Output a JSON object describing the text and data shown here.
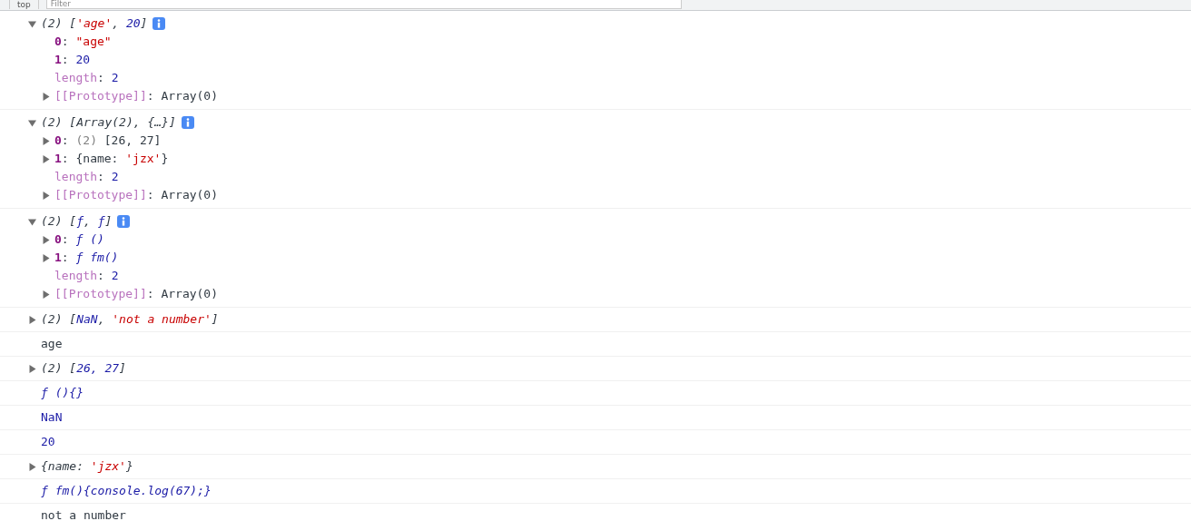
{
  "toolbar": {
    "context": "top",
    "filter": {
      "placeholder": "Filter"
    }
  },
  "entries": [
    {
      "expanded": true,
      "tokens": [
        {
          "text": "(2) [",
          "kind": "plain"
        },
        {
          "text": "'age'",
          "kind": "string"
        },
        {
          "text": ", ",
          "kind": "plain"
        },
        {
          "text": "20",
          "kind": "number"
        },
        {
          "text": "]",
          "kind": "plain"
        }
      ],
      "children": [
        {
          "tokens": [
            {
              "text": "0",
              "kind": "index"
            },
            {
              "text": ": ",
              "kind": "plain"
            },
            {
              "text": "\"age\"",
              "kind": "string"
            }
          ]
        },
        {
          "tokens": [
            {
              "text": "1",
              "kind": "index"
            },
            {
              "text": ": ",
              "kind": "plain"
            },
            {
              "text": "20",
              "kind": "number"
            }
          ]
        },
        {
          "tokens": [
            {
              "text": "length",
              "kind": "prop"
            },
            {
              "text": ": ",
              "kind": "plain"
            },
            {
              "text": "2",
              "kind": "number"
            }
          ]
        },
        {
          "expanded": false,
          "tokens": [
            {
              "text": "[[Prototype]]",
              "kind": "prop"
            },
            {
              "text": ": Array(0)",
              "kind": "plain"
            }
          ]
        }
      ]
    },
    {
      "expanded": true,
      "tokens": [
        {
          "text": "(2) [Array(2), {…}]",
          "kind": "plain"
        }
      ],
      "children": [
        {
          "expanded": false,
          "tokens": [
            {
              "text": "0",
              "kind": "index"
            },
            {
              "text": ": ",
              "kind": "plain"
            },
            {
              "text": "(2) ",
              "kind": "dim"
            },
            {
              "text": "[26, 27]",
              "kind": "plain"
            }
          ]
        },
        {
          "expanded": false,
          "tokens": [
            {
              "text": "1",
              "kind": "index"
            },
            {
              "text": ": {name: ",
              "kind": "plain"
            },
            {
              "text": "'jzx'",
              "kind": "string"
            },
            {
              "text": "}",
              "kind": "plain"
            }
          ]
        },
        {
          "tokens": [
            {
              "text": "length",
              "kind": "prop"
            },
            {
              "text": ": ",
              "kind": "plain"
            },
            {
              "text": "2",
              "kind": "number"
            }
          ]
        },
        {
          "expanded": false,
          "tokens": [
            {
              "text": "[[Prototype]]",
              "kind": "prop"
            },
            {
              "text": ": Array(0)",
              "kind": "plain"
            }
          ]
        }
      ]
    },
    {
      "expanded": true,
      "tokens": [
        {
          "text": "(2) [",
          "kind": "plain"
        },
        {
          "text": "ƒ",
          "kind": "func"
        },
        {
          "text": ", ",
          "kind": "plain"
        },
        {
          "text": "ƒ",
          "kind": "func"
        },
        {
          "text": "]",
          "kind": "plain"
        }
      ],
      "children": [
        {
          "expanded": false,
          "tokens": [
            {
              "text": "0",
              "kind": "index"
            },
            {
              "text": ": ",
              "kind": "plain"
            },
            {
              "text": "ƒ ()",
              "kind": "func"
            }
          ]
        },
        {
          "expanded": false,
          "tokens": [
            {
              "text": "1",
              "kind": "index"
            },
            {
              "text": ": ",
              "kind": "plain"
            },
            {
              "text": "ƒ fm()",
              "kind": "func"
            }
          ]
        },
        {
          "tokens": [
            {
              "text": "length",
              "kind": "prop"
            },
            {
              "text": ": ",
              "kind": "plain"
            },
            {
              "text": "2",
              "kind": "number"
            }
          ]
        },
        {
          "expanded": false,
          "tokens": [
            {
              "text": "[[Prototype]]",
              "kind": "prop"
            },
            {
              "text": ": Array(0)",
              "kind": "plain"
            }
          ]
        }
      ]
    },
    {
      "expanded": false,
      "tokens": [
        {
          "text": "(2) [",
          "kind": "plain"
        },
        {
          "text": "NaN",
          "kind": "number"
        },
        {
          "text": ", ",
          "kind": "plain"
        },
        {
          "text": "'not a number'",
          "kind": "string"
        },
        {
          "text": "]",
          "kind": "plain"
        }
      ]
    },
    {
      "tokens": [
        {
          "text": "age",
          "kind": "plain"
        }
      ]
    },
    {
      "expanded": false,
      "tokens": [
        {
          "text": "(2) [",
          "kind": "plain"
        },
        {
          "text": "26, 27",
          "kind": "number"
        },
        {
          "text": "]",
          "kind": "plain"
        }
      ]
    },
    {
      "tokens": [
        {
          "text": "ƒ (){}",
          "kind": "func"
        }
      ]
    },
    {
      "tokens": [
        {
          "text": "NaN",
          "kind": "number"
        }
      ]
    },
    {
      "tokens": [
        {
          "text": "20",
          "kind": "number"
        }
      ]
    },
    {
      "expanded": false,
      "tokens": [
        {
          "text": "{name: ",
          "kind": "plain"
        },
        {
          "text": "'jzx'",
          "kind": "string"
        },
        {
          "text": "}",
          "kind": "plain"
        }
      ]
    },
    {
      "tokens": [
        {
          "text": "ƒ fm(){console.log(67);}",
          "kind": "func"
        }
      ]
    },
    {
      "tokens": [
        {
          "text": "not a number",
          "kind": "plain"
        }
      ]
    }
  ]
}
